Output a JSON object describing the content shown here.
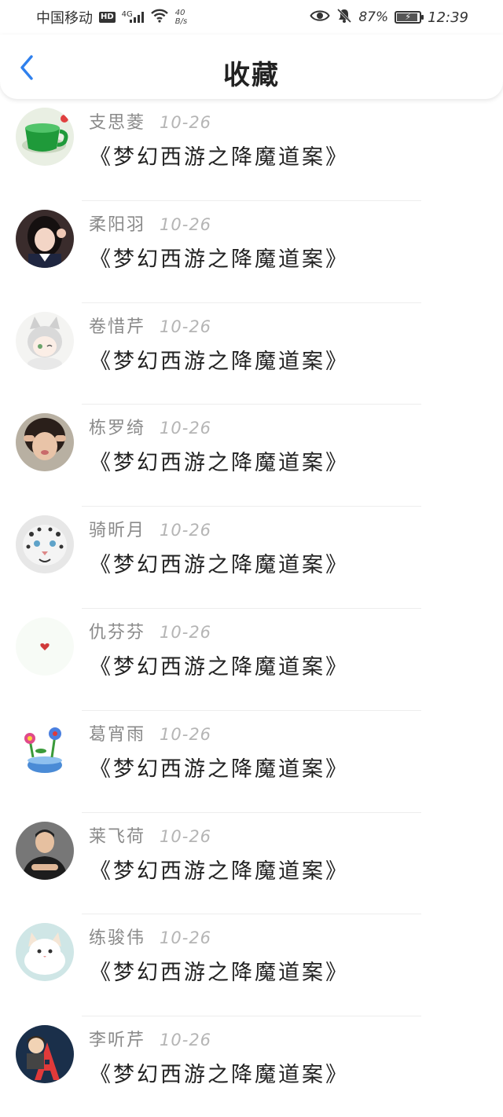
{
  "status_bar": {
    "carrier": "中国移动",
    "hd": "HD",
    "network": "4G",
    "speed_value": "40",
    "speed_unit": "B/s",
    "battery_text": "87%",
    "battery_level": 0.87,
    "time": "12:39",
    "icons": [
      "eye-icon",
      "mute-bell-icon",
      "wifi-icon",
      "signal-icon",
      "battery-icon"
    ]
  },
  "header": {
    "title": "收藏",
    "back_icon": "chevron-left-icon",
    "accent_color": "#2f80ed"
  },
  "favorites": [
    {
      "name": "支思菱",
      "date": "10-26",
      "title": "《梦幻西游之降魔道案》",
      "avatar": "green-cup"
    },
    {
      "name": "柔阳羽",
      "date": "10-26",
      "title": "《梦幻西游之降魔道案》",
      "avatar": "girl-portrait"
    },
    {
      "name": "卷惜芹",
      "date": "10-26",
      "title": "《梦幻西游之降魔道案》",
      "avatar": "anime-cat-girl"
    },
    {
      "name": "栋罗绮",
      "date": "10-26",
      "title": "《梦幻西游之降魔道案》",
      "avatar": "girl-pose"
    },
    {
      "name": "骑昕月",
      "date": "10-26",
      "title": "《梦幻西游之降魔道案》",
      "avatar": "snow-leopard"
    },
    {
      "name": "仇芬芬",
      "date": "10-26",
      "title": "《梦幻西游之降魔道案》",
      "avatar": "small-heart"
    },
    {
      "name": "葛宵雨",
      "date": "10-26",
      "title": "《梦幻西游之降魔道案》",
      "avatar": "flower-pot"
    },
    {
      "name": "莱飞荷",
      "date": "10-26",
      "title": "《梦幻西游之降魔道案》",
      "avatar": "man-arms-crossed"
    },
    {
      "name": "练骏伟",
      "date": "10-26",
      "title": "《梦幻西游之降魔道案》",
      "avatar": "white-kitten"
    },
    {
      "name": "李听芹",
      "date": "10-26",
      "title": "《梦幻西游之降魔道案》",
      "avatar": "cartoon-letter-a"
    }
  ]
}
